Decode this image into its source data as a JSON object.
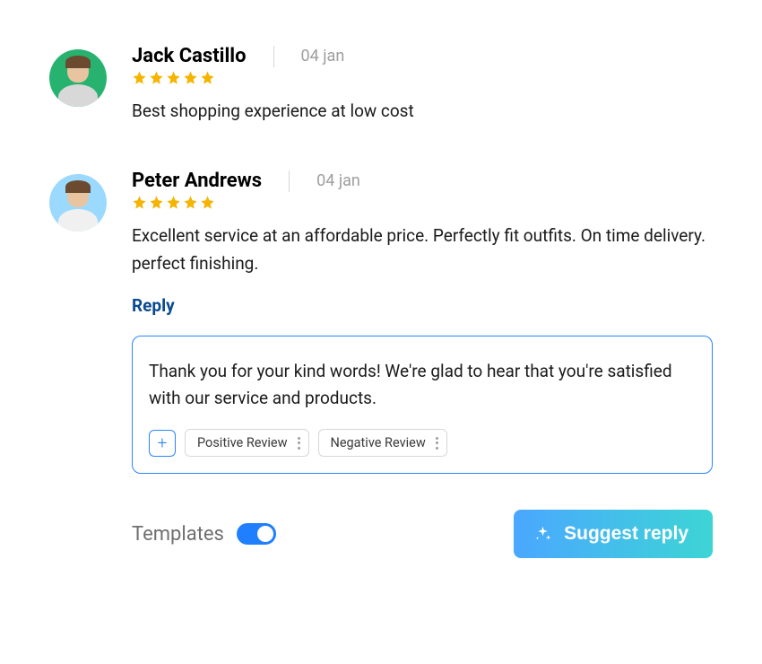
{
  "reviews": [
    {
      "name": "Jack Castillo",
      "date": "04 jan",
      "rating": 5,
      "text": "Best shopping experience at low cost"
    },
    {
      "name": "Peter Andrews",
      "date": "04 jan",
      "rating": 5,
      "text": "Excellent service at an affordable price. Perfectly fit outfits. On time delivery. perfect finishing.",
      "reply_label": "Reply",
      "reply_draft": "Thank you for your kind words! We're glad to hear that you're satisfied with our service and products."
    }
  ],
  "template_chips": [
    {
      "label": "Positive Review"
    },
    {
      "label": "Negative Review"
    }
  ],
  "footer": {
    "templates_label": "Templates",
    "toggle_on": true,
    "suggest_label": "Suggest reply"
  },
  "colors": {
    "accent_blue": "#2b85ff",
    "star_gold": "#f5b400",
    "reply_link": "#0b4a8f"
  }
}
